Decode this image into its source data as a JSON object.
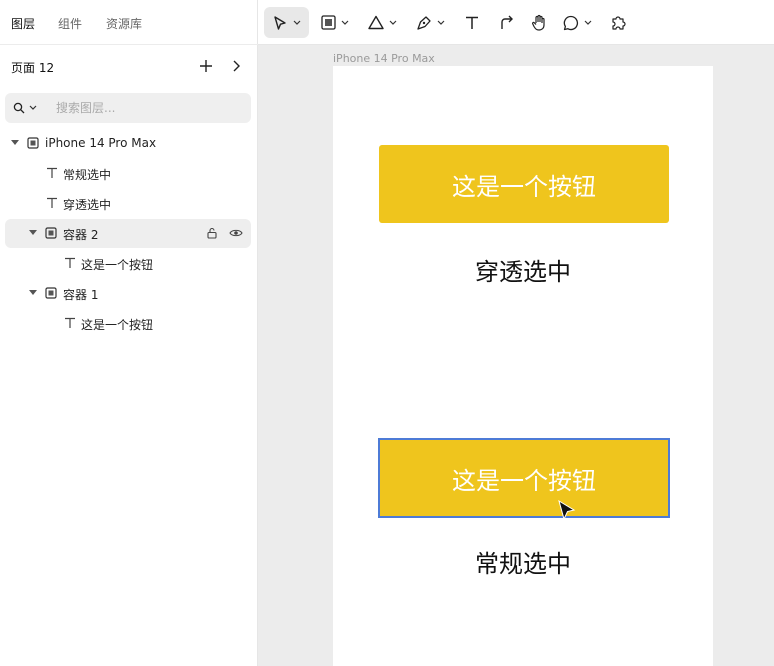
{
  "left_panel": {
    "tabs": [
      "图层",
      "组件",
      "资源库"
    ],
    "page_title": "页面 12",
    "search_placeholder": "搜索图层...",
    "layers": [
      {
        "label": "iPhone 14 Pro Max",
        "type": "frame",
        "expanded": true,
        "level": 0
      },
      {
        "label": "常规选中",
        "type": "text",
        "level": 1
      },
      {
        "label": "穿透选中",
        "type": "text",
        "level": 1
      },
      {
        "label": "容器 2",
        "type": "frame",
        "expanded": true,
        "level": 1,
        "selected": true
      },
      {
        "label": "这是一个按钮",
        "type": "text",
        "level": 2
      },
      {
        "label": "容器 1",
        "type": "frame",
        "expanded": true,
        "level": 1
      },
      {
        "label": "这是一个按钮",
        "type": "text",
        "level": 2
      }
    ]
  },
  "toolbar": {
    "tools": [
      "move-tool",
      "rectangle-tool",
      "triangle-tool",
      "pen-tool",
      "text-tool",
      "connector-tool",
      "hand-tool",
      "comment-tool",
      "plugin-tool"
    ],
    "active_tool": "move-tool"
  },
  "canvas": {
    "frame_label": "iPhone 14 Pro Max",
    "button_top_label": "这是一个按钮",
    "caption_top": "穿透选中",
    "button_bottom_label": "这是一个按钮",
    "caption_bottom": "常规选中",
    "button_color": "#efc51d",
    "selection_color": "#4d7bd6"
  }
}
